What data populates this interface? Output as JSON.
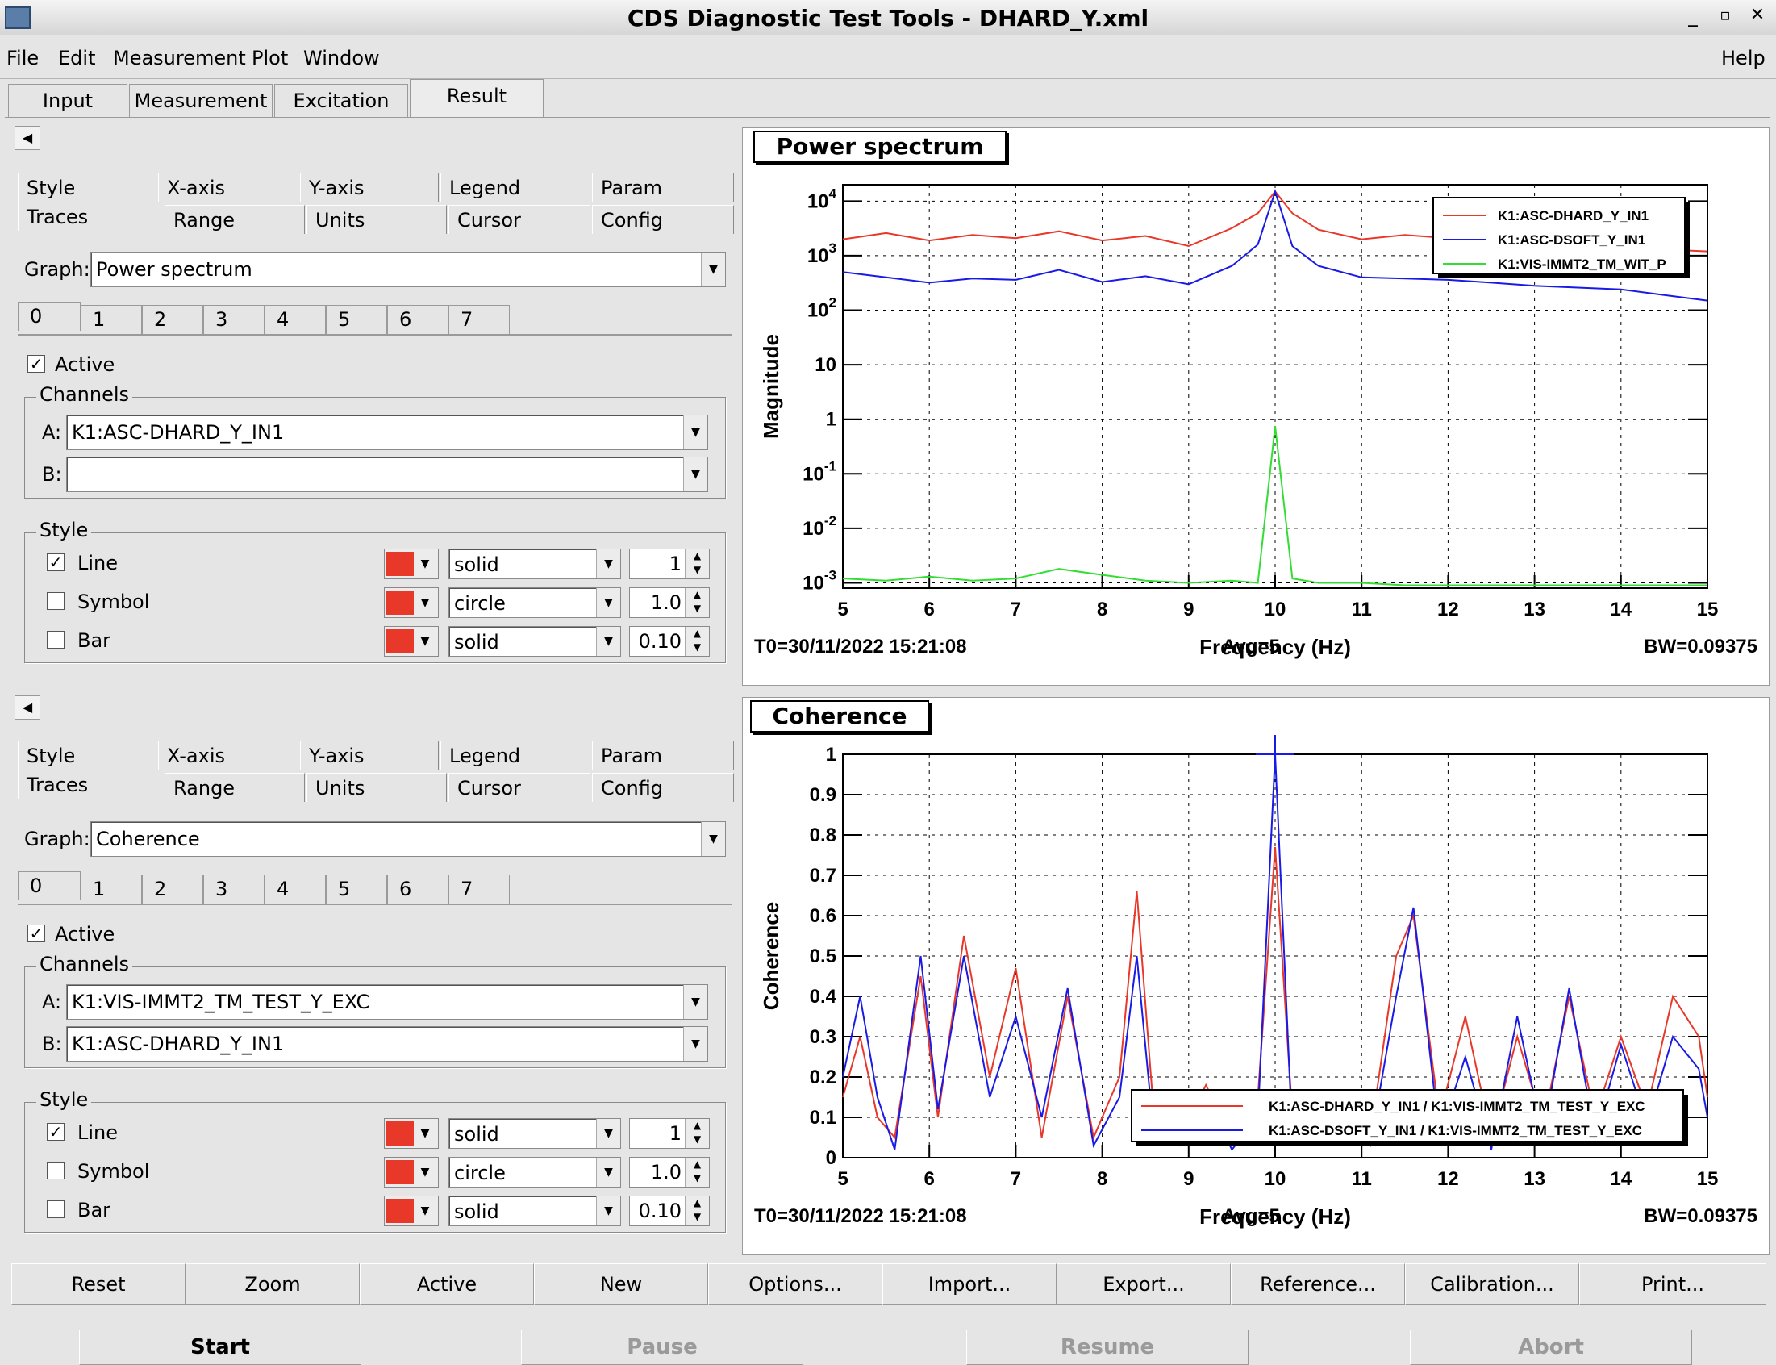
{
  "window": {
    "title": "CDS Diagnostic Test Tools - DHARD_Y.xml",
    "controls": [
      "_",
      "▫",
      "✕"
    ]
  },
  "menu": {
    "file": "File",
    "edit": "Edit",
    "measurement": "Measurement",
    "plot": "Plot",
    "window": "Window",
    "help": "Help"
  },
  "main_tabs": [
    "Input",
    "Measurement",
    "Excitation",
    "Result"
  ],
  "sub_tabs_row1": [
    "Style",
    "X-axis",
    "Y-axis",
    "Legend",
    "Param"
  ],
  "sub_tabs_row2": [
    "Traces",
    "Range",
    "Units",
    "Cursor",
    "Config"
  ],
  "trace_tabs": [
    "0",
    "1",
    "2",
    "3",
    "4",
    "5",
    "6",
    "7"
  ],
  "labels": {
    "graph": "Graph:",
    "active": "Active",
    "channels": "Channels",
    "a": "A:",
    "b": "B:",
    "style": "Style",
    "line": "Line",
    "symbol": "Symbol",
    "bar": "Bar"
  },
  "panel1": {
    "graph": "Power spectrum",
    "active_checked": "✓",
    "channel_a": "K1:ASC-DHARD_Y_IN1",
    "channel_b": "",
    "line_checked": "✓",
    "symbol_checked": "",
    "bar_checked": "",
    "line_style": "solid",
    "line_width": "1",
    "symbol_style": "circle",
    "symbol_size": "1.0",
    "bar_style": "solid",
    "bar_width": "0.10"
  },
  "panel2": {
    "graph": "Coherence",
    "active_checked": "✓",
    "channel_a": "K1:VIS-IMMT2_TM_TEST_Y_EXC",
    "channel_b": "K1:ASC-DHARD_Y_IN1",
    "line_checked": "✓",
    "symbol_checked": "",
    "bar_checked": "",
    "line_style": "solid",
    "line_width": "1",
    "symbol_style": "circle",
    "symbol_size": "1.0",
    "bar_style": "solid",
    "bar_width": "0.10"
  },
  "plot1": {
    "title": "Power spectrum",
    "t0": "T0=30/11/2022 15:21:08",
    "avg": "Avg=5",
    "bw": "BW=0.09375"
  },
  "plot2": {
    "title": "Coherence",
    "t0": "T0=30/11/2022 15:21:08",
    "avg": "Avg=5",
    "bw": "BW=0.09375"
  },
  "bottom_buttons": [
    "Reset",
    "Zoom",
    "Active",
    "New",
    "Options...",
    "Import...",
    "Export...",
    "Reference...",
    "Calibration...",
    "Print..."
  ],
  "controls": {
    "start": "Start",
    "pause": "Pause",
    "resume": "Resume",
    "abort": "Abort"
  },
  "colors": {
    "red": "#e8382a",
    "blue": "#1a1ae6",
    "green": "#33dd33"
  },
  "chart_data": [
    {
      "type": "line",
      "title": "Power spectrum",
      "xlabel": "Frequency (Hz)",
      "ylabel": "Magnitude",
      "xlim": [
        5,
        15
      ],
      "ylim": [
        0.0008,
        20000
      ],
      "yscale": "log",
      "x_ticks": [
        "5",
        "6",
        "7",
        "8",
        "9",
        "10",
        "11",
        "12",
        "13",
        "14",
        "15"
      ],
      "y_ticks": [
        "10^-3",
        "10^-2",
        "10^-1",
        "1",
        "10",
        "10^2",
        "10^3",
        "10^4"
      ],
      "grid": true,
      "legend_position": "top-right",
      "x": [
        5,
        5.5,
        6,
        6.5,
        7,
        7.5,
        8,
        8.5,
        9,
        9.5,
        9.8,
        10,
        10.2,
        10.5,
        11,
        11.5,
        12,
        12.5,
        13,
        13.5,
        14,
        14.5,
        15
      ],
      "series": [
        {
          "name": "K1:ASC-DHARD_Y_IN1",
          "color": "#e8382a",
          "values": [
            2000,
            2600,
            1900,
            2400,
            2100,
            2800,
            1900,
            2300,
            1500,
            3200,
            6000,
            15000,
            6000,
            3000,
            2000,
            2400,
            2100,
            1800,
            2000,
            1700,
            1500,
            1300,
            1200
          ]
        },
        {
          "name": "K1:ASC-DSOFT_Y_IN1",
          "color": "#1a1ae6",
          "values": [
            500,
            400,
            320,
            380,
            360,
            550,
            330,
            420,
            300,
            650,
            1600,
            15000,
            1500,
            650,
            400,
            380,
            360,
            320,
            280,
            260,
            240,
            190,
            150
          ]
        },
        {
          "name": "K1:VIS-IMMT2_TM_WIT_P",
          "color": "#33dd33",
          "values": [
            0.0012,
            0.0011,
            0.0013,
            0.0011,
            0.0012,
            0.0018,
            0.0014,
            0.0011,
            0.001,
            0.0011,
            0.001,
            0.75,
            0.0012,
            0.001,
            0.001,
            0.0009,
            0.0009,
            0.0009,
            0.0009,
            0.0009,
            0.0009,
            0.0009,
            0.0009
          ]
        }
      ]
    },
    {
      "type": "line",
      "title": "Coherence",
      "xlabel": "Frequency (Hz)",
      "ylabel": "Coherence",
      "xlim": [
        5,
        15
      ],
      "ylim": [
        0,
        1
      ],
      "x_ticks": [
        "5",
        "6",
        "7",
        "8",
        "9",
        "10",
        "11",
        "12",
        "13",
        "14",
        "15"
      ],
      "y_ticks": [
        "0",
        "0.1",
        "0.2",
        "0.3",
        "0.4",
        "0.5",
        "0.6",
        "0.7",
        "0.8",
        "0.9",
        "1"
      ],
      "grid": true,
      "legend_position": "bottom-right",
      "x": [
        5,
        5.2,
        5.4,
        5.6,
        5.9,
        6.1,
        6.4,
        6.7,
        7.0,
        7.3,
        7.6,
        7.9,
        8.2,
        8.4,
        8.6,
        8.9,
        9.2,
        9.5,
        9.8,
        10.0,
        10.2,
        10.5,
        10.8,
        11.1,
        11.4,
        11.6,
        11.9,
        12.2,
        12.5,
        12.8,
        13.1,
        13.4,
        13.7,
        14.0,
        14.3,
        14.6,
        14.9,
        15
      ],
      "series": [
        {
          "name": "K1:ASC-DHARD_Y_IN1 / K1:VIS-IMMT2_TM_TEST_Y_EXC",
          "color": "#e8382a",
          "values": [
            0.15,
            0.3,
            0.1,
            0.05,
            0.45,
            0.1,
            0.55,
            0.2,
            0.47,
            0.05,
            0.4,
            0.05,
            0.2,
            0.66,
            0.1,
            0.05,
            0.18,
            0.05,
            0.15,
            0.77,
            0.1,
            0.05,
            0.12,
            0.05,
            0.5,
            0.6,
            0.1,
            0.35,
            0.05,
            0.3,
            0.08,
            0.4,
            0.1,
            0.3,
            0.12,
            0.4,
            0.3,
            0.15
          ]
        },
        {
          "name": "K1:ASC-DSOFT_Y_IN1 / K1:VIS-IMMT2_TM_TEST_Y_EXC",
          "color": "#1a1ae6",
          "values": [
            0.2,
            0.4,
            0.15,
            0.02,
            0.5,
            0.12,
            0.5,
            0.15,
            0.35,
            0.1,
            0.42,
            0.03,
            0.15,
            0.5,
            0.05,
            0.03,
            0.15,
            0.02,
            0.1,
            1.0,
            0.05,
            0.03,
            0.08,
            0.03,
            0.4,
            0.62,
            0.05,
            0.25,
            0.02,
            0.35,
            0.05,
            0.42,
            0.05,
            0.28,
            0.08,
            0.3,
            0.22,
            0.1
          ]
        }
      ]
    }
  ]
}
